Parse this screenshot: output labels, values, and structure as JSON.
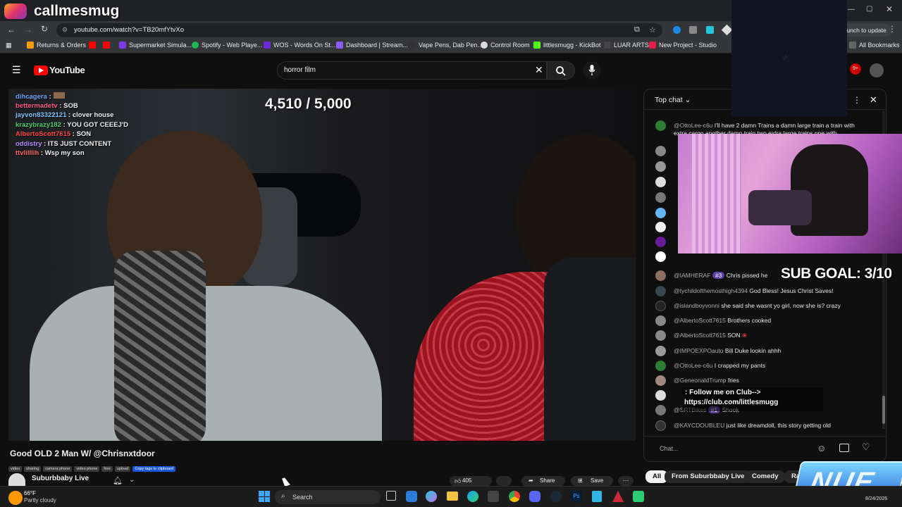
{
  "overlay_brand": {
    "name": "callmesmug"
  },
  "browser": {
    "url": "youtube.com/watch?v=TB20mfYtvXo",
    "relaunch_label": "Relaunch to update",
    "all_bookmarks_label": "All Bookmarks",
    "bookmarks": [
      {
        "label": "Returns & Orders",
        "color": "#f59e0b"
      },
      {
        "label": "Supermarket Simula...",
        "color": "#7c3aed"
      },
      {
        "label": "Spotify - Web Playe...",
        "color": "#1db954"
      },
      {
        "label": "WOS - Words On St...",
        "color": "#6d28d9"
      },
      {
        "label": "Dashboard | Stream...",
        "color": "#8b5cf6"
      },
      {
        "label": "Vape Pens, Dab Pen...",
        "color": "#333333"
      },
      {
        "label": "Control Room",
        "color": "#dddddd"
      },
      {
        "label": "littlesmugg - KickBot",
        "color": "#53fc18"
      },
      {
        "label": "LUAR ARTS",
        "color": "#444444"
      },
      {
        "label": "New Project - Studio",
        "color": "#e11d48"
      }
    ]
  },
  "youtube": {
    "logo_text": "YouTube",
    "search_query": "horror film",
    "notif_count": "9+"
  },
  "stream_overlay": {
    "counter": "4,510 / 5,000",
    "sub_goal": "SUB GOAL: 3/10",
    "club_line1": ": Follow me on Club-->",
    "club_line2": "https://club.com/littlesmugg",
    "chat_lines": [
      {
        "user": "dihcagera",
        "msg": "",
        "color": "#6fa8ff"
      },
      {
        "user": "bettermadetv",
        "msg": ": SOB",
        "color": "#ff5a8a"
      },
      {
        "user": "jayvon83322121",
        "msg": ": clover house",
        "color": "#7cc4ff"
      },
      {
        "user": "krazybrazy182",
        "msg": ": YOU GOT CEEEJ'D",
        "color": "#46d36b"
      },
      {
        "user": "AlbertoScott7615",
        "msg": ": SON",
        "color": "#ff4444"
      },
      {
        "user": "oddistry",
        "msg": ": ITS JUST CONTENT",
        "color": "#b28cff"
      },
      {
        "user": "ttvlilllih",
        "msg": ": Wsp my son",
        "color": "#ff6666"
      }
    ]
  },
  "video": {
    "title": "Good OLD 2 Man W/ @Chrisnxtdoor",
    "tags": [
      "video",
      "sharing",
      "camera phone",
      "video phone",
      "free",
      "upload"
    ],
    "copy_tags_label": "Copy tags to clipboard",
    "channel": "Suburbbaby Live",
    "likes": "405",
    "share_label": "Share",
    "save_label": "Save"
  },
  "live_chat": {
    "header": "Top chat",
    "input_placeholder": "Chat...",
    "messages": [
      {
        "user": "@OttoLee-c6u",
        "msg": "I'll have 2 damn Trains a damn large train a train with",
        "msg2": "extra cargo another damn train two extra large trains one with",
        "avatar": "#2e7d32"
      },
      {
        "user": "@IAMHERAF",
        "badge": "#3",
        "msg": "Chris pissed he",
        "avatar": "#8d6e63"
      },
      {
        "user": "@tychildofthemosthigh4394",
        "msg": "God Bless! Jesus Christ Saves!",
        "avatar": "#37474f"
      },
      {
        "user": "@islandboyvonni",
        "msg": "she said she wasnt yo girl, now she is? crazy",
        "avatar": "#222222"
      },
      {
        "user": "@AlbertoScott7615",
        "msg": "Brothers cooked",
        "avatar": "#888888"
      },
      {
        "user": "@AlbertoScott7615",
        "msg": "SON",
        "avatar": "#888888"
      },
      {
        "user": "@IMPOEXPOauto",
        "msg": "Bill Duke lookin ahhh",
        "avatar": "#999999"
      },
      {
        "user": "@OttoLee-c6u",
        "msg": "I crapped my pants",
        "avatar": "#2e7d32"
      },
      {
        "user": "@GeneonaldTrump",
        "msg": "fries",
        "avatar": "#a1887f"
      },
      {
        "user": "@SRTBikes",
        "badge": "#1",
        "msg": "Shook",
        "avatar": "#777777"
      },
      {
        "user": "@KAYCDOUBLEU",
        "msg": "just like dreamdoll, this story getting old",
        "avatar": "#333333"
      }
    ]
  },
  "chips": [
    "All",
    "From Suburbbaby Live",
    "Comedy",
    "Ra"
  ],
  "taskbar": {
    "weather_temp": "66°F",
    "weather_desc": "Partly cloudy",
    "search_label": "Search",
    "date": "8/24/2026"
  }
}
